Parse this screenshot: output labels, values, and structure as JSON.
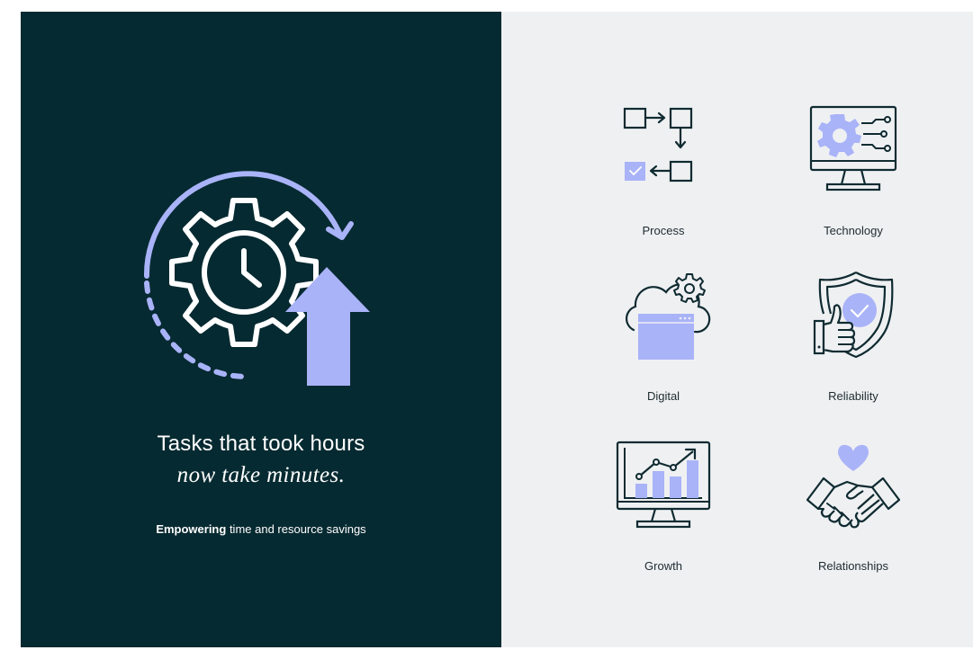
{
  "hero": {
    "headline_line1": "Tasks that took hours",
    "headline_line2": "now take minutes.",
    "subline_bold": "Empowering",
    "subline_rest": " time and resource savings",
    "icon": "gear-clock-upward-arrow-icon"
  },
  "features": [
    {
      "label": "Process",
      "icon": "process-flow-icon"
    },
    {
      "label": "Technology",
      "icon": "monitor-gear-circuit-icon"
    },
    {
      "label": "Digital",
      "icon": "cloud-window-gear-icon"
    },
    {
      "label": "Reliability",
      "icon": "shield-check-thumbs-up-icon"
    },
    {
      "label": "Growth",
      "icon": "monitor-bar-chart-icon"
    },
    {
      "label": "Relationships",
      "icon": "handshake-heart-icon"
    }
  ],
  "colors": {
    "dark_panel": "#062a31",
    "light_panel": "#eff0f2",
    "accent": "#a9b3f8",
    "ink": "#0f2b31",
    "text_on_dark": "#ffffff"
  }
}
